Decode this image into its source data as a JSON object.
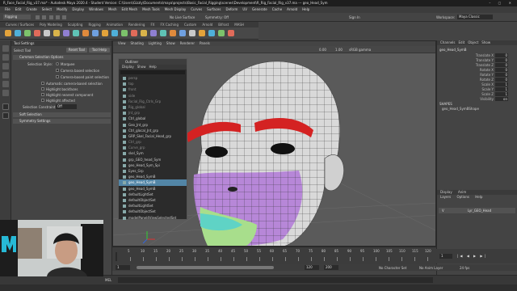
{
  "window": {
    "title": "R_Face_Facial_Rig_v37.ma* - Autodesk Maya 2020.4 - Student Version: C:\\Users\\Gizzly\\Documents\\maya\\projects\\Basic_Facial_Rigging\\scenes\\Development\\R_Rig_Facial_Rig_v37.ma --- geo_Head_Sym",
    "controls": "–  ▢  ✕"
  },
  "menus": [
    "File",
    "Edit",
    "Create",
    "Select",
    "Modify",
    "Display",
    "Windows",
    "Mesh",
    "Edit Mesh",
    "Mesh Tools",
    "Mesh Display",
    "Curves",
    "Surfaces",
    "Deform",
    "UV",
    "Generate",
    "Cache",
    "Arnold",
    "Help"
  ],
  "status": {
    "mode": "Rigging",
    "no_live_surface": "No Live Surface",
    "symmetry": "Symmetry: Off",
    "sign_in": "Sign In",
    "workspace_label": "Workspace:",
    "workspace_value": "Maya Classic"
  },
  "shelf_tabs": [
    "Curves / Surfaces",
    "Poly Modeling",
    "Sculpting",
    "Rigging",
    "Animation",
    "Rendering",
    "FX",
    "FX Caching",
    "Custom",
    "Arnold",
    "Bifrost",
    "MASH",
    "Motion Graphics",
    "XGen",
    "Rig_Tools"
  ],
  "tool_settings": {
    "header": "Tool Settings",
    "tool_name": "Select Tool",
    "reset": "Reset Tool",
    "help": "Tool Help",
    "section": "Common Selection Options",
    "selection_style_label": "Selection Style:",
    "options": [
      "Marquee",
      "Camera based selection",
      "Camera-based paint selection",
      "Automatic camera-based selection",
      "Highlight backfaces",
      "Highlight nearest component",
      "Highlight affected"
    ],
    "selection_constraint_label": "Selection Constraint:",
    "selection_constraint_value": "Off",
    "soft_selection": "Soft Selection",
    "symmetry_settings": "Symmetry Settings"
  },
  "viewport": {
    "menus": [
      "View",
      "Shading",
      "Lighting",
      "Show",
      "Renderer",
      "Panels"
    ],
    "camera_label": "persp",
    "color_space": "sRGB gamma",
    "value_a": "0.00",
    "value_b": "1.00"
  },
  "outliner": {
    "title": "Outliner",
    "menus": [
      "Display",
      "Show",
      "Help"
    ],
    "items": [
      {
        "label": "persp",
        "dim": true
      },
      {
        "label": "top",
        "dim": true
      },
      {
        "label": "front",
        "dim": true
      },
      {
        "label": "side",
        "dim": true
      },
      {
        "label": "Facial_Rig_Ctrls_Grp",
        "dim": true
      },
      {
        "label": "Rig_global",
        "dim": true
      },
      {
        "label": "Jnt_grp",
        "dim": true
      },
      {
        "label": "Ctrl_global",
        "dim": false
      },
      {
        "label": "Geo_Jnt_grp",
        "dim": false
      },
      {
        "label": "Ctrl_glocal_Jnt_grp",
        "dim": false
      },
      {
        "label": "GRP_Skel_Facial_Head_grp",
        "dim": false
      },
      {
        "label": "Ctrl_grp",
        "dim": true
      },
      {
        "label": "Curve_grp",
        "dim": true
      },
      {
        "label": "skel_Sym",
        "dim": false
      },
      {
        "label": "grp_GEO_head_Sym",
        "dim": false
      },
      {
        "label": "geo_Head_Sym_Spi",
        "dim": false
      },
      {
        "label": "Eyes_Grp",
        "dim": false
      },
      {
        "label": "geo_Head_SymB",
        "dim": false
      },
      {
        "label": "geo_Head_SymB",
        "dim": false,
        "selected": true
      },
      {
        "label": "geo_Head_SymB",
        "dim": false
      },
      {
        "label": "defaultLightSet",
        "dim": false
      },
      {
        "label": "defaultObjectSet",
        "dim": false
      },
      {
        "label": "defaultLightSet",
        "dim": false
      },
      {
        "label": "defaultObjectSet",
        "dim": false
      },
      {
        "label": "modelPanel4ViewSelectedSet",
        "dim": false
      }
    ]
  },
  "channel_box": {
    "tabs": [
      "Channels",
      "Edit",
      "Object",
      "Show"
    ],
    "object": "geo_Head_SymB",
    "attrs": [
      {
        "name": "Translate X",
        "value": "0"
      },
      {
        "name": "Translate Y",
        "value": "0"
      },
      {
        "name": "Translate Z",
        "value": "0"
      },
      {
        "name": "Rotate X",
        "value": "0"
      },
      {
        "name": "Rotate Y",
        "value": "0"
      },
      {
        "name": "Rotate Z",
        "value": "0"
      },
      {
        "name": "Scale X",
        "value": "1"
      },
      {
        "name": "Scale Y",
        "value": "1"
      },
      {
        "name": "Scale Z",
        "value": "1"
      },
      {
        "name": "Visibility",
        "value": "on"
      }
    ],
    "shapes_label": "SHAPES",
    "shape_name": "geo_Head_SymBShape",
    "display_tabs": [
      "Display",
      "Anim"
    ],
    "layer_menus": [
      "Layers",
      "Options",
      "Help"
    ],
    "layer_name": "Lyr_GEO_Head"
  },
  "timeline": {
    "ticks": [
      "5",
      "10",
      "15",
      "20",
      "25",
      "30",
      "35",
      "40",
      "45",
      "50",
      "55",
      "60",
      "65",
      "70",
      "75",
      "80",
      "85",
      "90",
      "95",
      "100",
      "105",
      "110",
      "115",
      "120"
    ],
    "start": "1",
    "end": "120",
    "range_end": "200",
    "character_set": "No Character Set",
    "anim_layer": "No Anim Layer",
    "fps": "24 fps",
    "current": "1"
  },
  "cmd": {
    "lang": "MEL"
  },
  "colors": {
    "brow": "#d42222",
    "face_purple": "#b583d8",
    "jaw_green": "#a8de8c",
    "lip_cyan": "#5fd3c5",
    "selected_row": "#5285a6"
  }
}
